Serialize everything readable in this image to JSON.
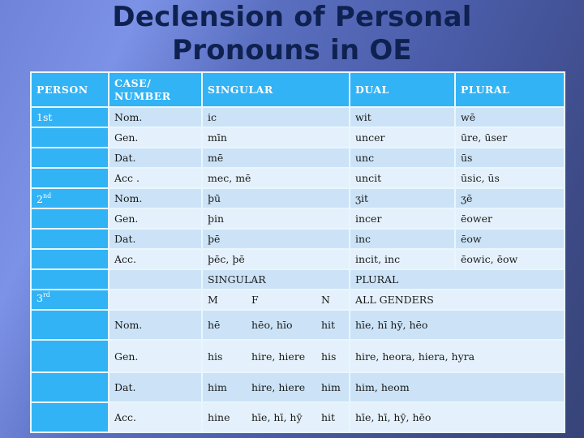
{
  "title": {
    "line1": "Declension of Personal",
    "line2": "Pronouns in OE"
  },
  "header": {
    "person": "PERSON",
    "case_number_line1": "CASE/",
    "case_number_line2": "NUMBER",
    "singular": "SINGULAR",
    "dual": "DUAL",
    "plural": "PLURAL"
  },
  "first_person": {
    "label": "1st",
    "rows": [
      {
        "case": "Nom.",
        "singular": "ic",
        "dual": "wit",
        "plural": "wē"
      },
      {
        "case": "Gen.",
        "singular": "mīn",
        "dual": "uncer",
        "plural": "ūre, ūser"
      },
      {
        "case": "Dat.",
        "singular": "mē",
        "dual": "unc",
        "plural": "ūs"
      },
      {
        "case": "Acc .",
        "singular": "mec, mē",
        "dual": "uncit",
        "plural": "ūsic, ūs"
      }
    ]
  },
  "second_person": {
    "label_num": "2",
    "label_sup": "nd",
    "rows": [
      {
        "case": "Nom.",
        "singular": "þū",
        "dual": "ʒit",
        "plural": "ʒē"
      },
      {
        "case": "Gen.",
        "singular": "þin",
        "dual": "incer",
        "plural": "ēower"
      },
      {
        "case": "Dat.",
        "singular": "þē",
        "dual": "inc",
        "plural": "ēow"
      },
      {
        "case": "Acc.",
        "singular": "þēc, þē",
        "dual": "incit, inc",
        "plural": "ēowic,  ēow"
      }
    ]
  },
  "third_person": {
    "label_num": "3",
    "label_sup": "rd",
    "subheader": {
      "singular": "SINGULAR",
      "plural": "PLURAL"
    },
    "genders": {
      "m": "M",
      "f": "F",
      "n": "N",
      "all": "ALL GENDERS"
    },
    "rows": [
      {
        "case": "Nom.",
        "m": "hē",
        "f": "hēo, hīo",
        "n": "hit",
        "plural": "hīe, hī  hȳ, hēo"
      },
      {
        "case": "Gen.",
        "m": "his",
        "f": "hire, hiere",
        "n": "his",
        "plural": "hire, heora, hiera, hyra"
      },
      {
        "case": "Dat.",
        "m": "him",
        "f": "hire, hiere",
        "n": "him",
        "plural": "him, heom"
      },
      {
        "case": "Acc.",
        "m": "hine",
        "f": "hīe, hī, hȳ",
        "n": "hit",
        "plural": "hīe,  hī,   hȳ,  hēo"
      }
    ]
  },
  "colors": {
    "header_bg": "#32b3f5",
    "row_dark": "#cce3f7",
    "row_light": "#e4f1fc",
    "title": "#0f2150"
  }
}
